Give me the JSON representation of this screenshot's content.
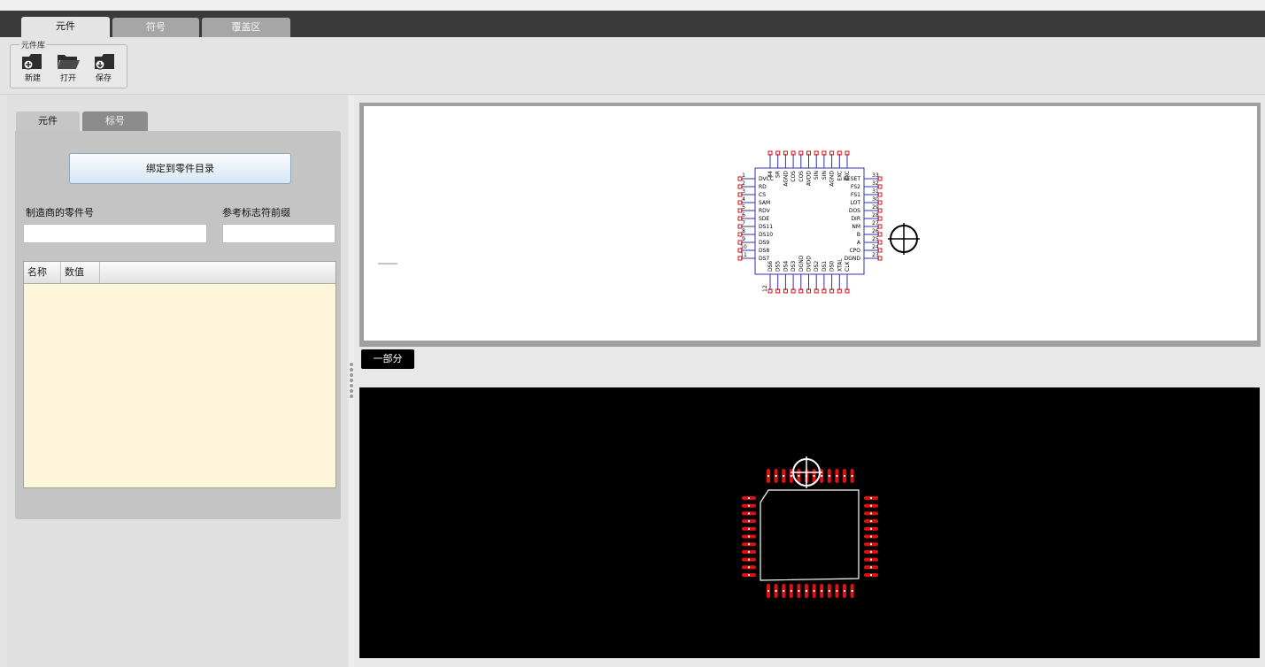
{
  "main_tabs": [
    {
      "label": "元件",
      "active": true
    },
    {
      "label": "符号",
      "active": false
    },
    {
      "label": "覆盖区",
      "active": false
    }
  ],
  "toolbar": {
    "group_label": "元件库",
    "buttons": [
      {
        "label": "新建",
        "icon": "new-folder-icon"
      },
      {
        "label": "打开",
        "icon": "open-folder-icon"
      },
      {
        "label": "保存",
        "icon": "save-folder-icon"
      }
    ]
  },
  "left_panel": {
    "tabs": [
      {
        "label": "元件",
        "active": true
      },
      {
        "label": "标号",
        "active": false
      }
    ],
    "bind_button": "绑定到零件目录",
    "manufacturer_part_label": "制造商的零件号",
    "manufacturer_part_value": "",
    "ref_prefix_label": "参考标志符前缀",
    "ref_prefix_value": "",
    "table": {
      "columns": [
        "名称",
        "数值"
      ],
      "rows": []
    }
  },
  "schematic": {
    "pins_left": [
      {
        "num": "1",
        "name": "DVCC"
      },
      {
        "num": "2",
        "name": "RD"
      },
      {
        "num": "3",
        "name": "CS"
      },
      {
        "num": "4",
        "name": "SAM"
      },
      {
        "num": "5",
        "name": "RDV"
      },
      {
        "num": "6",
        "name": "SDE"
      },
      {
        "num": "7",
        "name": "DS11"
      },
      {
        "num": "8",
        "name": "DS10"
      },
      {
        "num": "9",
        "name": "DS9"
      },
      {
        "num": "10",
        "name": "DS8"
      },
      {
        "num": "11",
        "name": "DS7"
      }
    ],
    "pins_right": [
      {
        "num": "33",
        "name": "RESET"
      },
      {
        "num": "32",
        "name": "FS2"
      },
      {
        "num": "31",
        "name": "FS1"
      },
      {
        "num": "30",
        "name": "LOT"
      },
      {
        "num": "29",
        "name": "DOS"
      },
      {
        "num": "28",
        "name": "DIR"
      },
      {
        "num": "27",
        "name": "NM"
      },
      {
        "num": "26",
        "name": "B"
      },
      {
        "num": "25",
        "name": "A"
      },
      {
        "num": "24",
        "name": "CPO"
      },
      {
        "num": "23",
        "name": "DGND"
      }
    ],
    "pins_top": [
      "44",
      "SR",
      "AGND",
      "COS",
      "COS",
      "AVDD",
      "SIN",
      "SIN",
      "AGND",
      "EXC",
      "EXC"
    ],
    "pins_bottom": [
      "DS6",
      "DS5",
      "DS4",
      "DS3",
      "DGND",
      "DVDD",
      "DS2",
      "DS1",
      "DS0",
      "XTAL",
      "CLK"
    ],
    "pin_bottom_first_num": "12"
  },
  "part_label": "一部分",
  "pcb": {
    "pads_top": 12,
    "pads_bottom": 12,
    "pads_left": 11,
    "pads_right": 11,
    "pad_color": "#e01010"
  }
}
